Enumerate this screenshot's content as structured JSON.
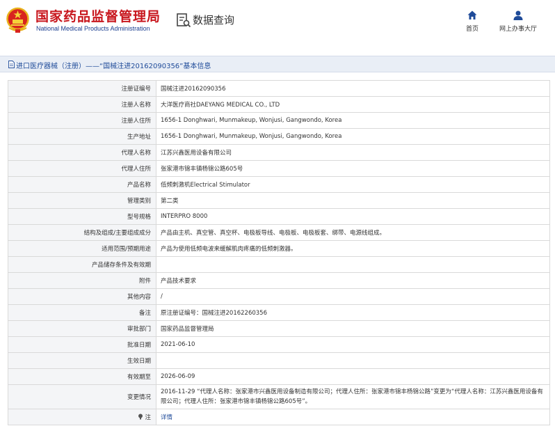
{
  "header": {
    "title_cn": "国家药品监督管理局",
    "title_en": "National Medical Products Administration",
    "query_title": "数据查询",
    "nav": {
      "home_label": "首页",
      "hall_label": "网上办事大厅"
    }
  },
  "title_bar": {
    "text": "进口医疗器械（注册）——“国械注进20162090356”基本信息"
  },
  "rows": [
    {
      "label": "注册证编号",
      "value": "国械注进20162090356"
    },
    {
      "label": "注册人名称",
      "value": "大洋医疗商社DAEYANG MEDICAL CO., LTD"
    },
    {
      "label": "注册人住所",
      "value": "1656-1 Donghwari, Munmakeup, Wonjusi, Gangwondo, Korea"
    },
    {
      "label": "生产地址",
      "value": "1656-1 Donghwari, Munmakeup, Wonjusi, Gangwondo, Korea"
    },
    {
      "label": "代理人名称",
      "value": "江苏兴鑫医用设备有限公司"
    },
    {
      "label": "代理人住所",
      "value": "张家港市锦丰镇杨锦公路605号"
    },
    {
      "label": "产品名称",
      "value": "低频刺激机Electrical Stimulator"
    },
    {
      "label": "管理类别",
      "value": "第二类"
    },
    {
      "label": "型号规格",
      "value": "INTERPRO 8000"
    },
    {
      "label": "结构及组成/主要组成成分",
      "value": "产品由主机、真空管、真空杯、电极板导线、电极板、电极板套、绑带、电源线组成。"
    },
    {
      "label": "适用范围/预期用途",
      "value": "产品为使用低频电波来缓解肌肉疼痛的低频刺激器。"
    },
    {
      "label": "产品储存条件及有效期",
      "value": ""
    },
    {
      "label": "附件",
      "value": "产品技术要求"
    },
    {
      "label": "其他内容",
      "value": "/"
    },
    {
      "label": "备注",
      "value": "原注册证编号：国械注进20162260356"
    },
    {
      "label": "审批部门",
      "value": "国家药品监督管理局"
    },
    {
      "label": "批准日期",
      "value": "2021-06-10"
    },
    {
      "label": "生效日期",
      "value": ""
    },
    {
      "label": "有效期至",
      "value": "2026-06-09"
    },
    {
      "label": "变更情况",
      "value": "2016-11-29 “代理人名称：张家港市兴鑫医用设备制造有限公司；代理人住所：张家港市锦丰杨锦公路”变更为“代理人名称：江苏兴鑫医用设备有限公司；代理人住所：张家港市锦丰镇杨锦公路605号”。"
    },
    {
      "label": "注",
      "value": "详情"
    }
  ],
  "colors": {
    "brand_red": "#c8161d",
    "brand_blue": "#1a3d8f",
    "link_blue": "#1f4b99",
    "label_bg": "#f4f5f7",
    "title_bar_bg": "#e9eef6"
  },
  "icons": {
    "emblem": "national-emblem-icon",
    "query": "data-query-icon",
    "home": "home-icon",
    "hall": "user-icon",
    "doc": "document-icon",
    "note": "note-icon"
  }
}
